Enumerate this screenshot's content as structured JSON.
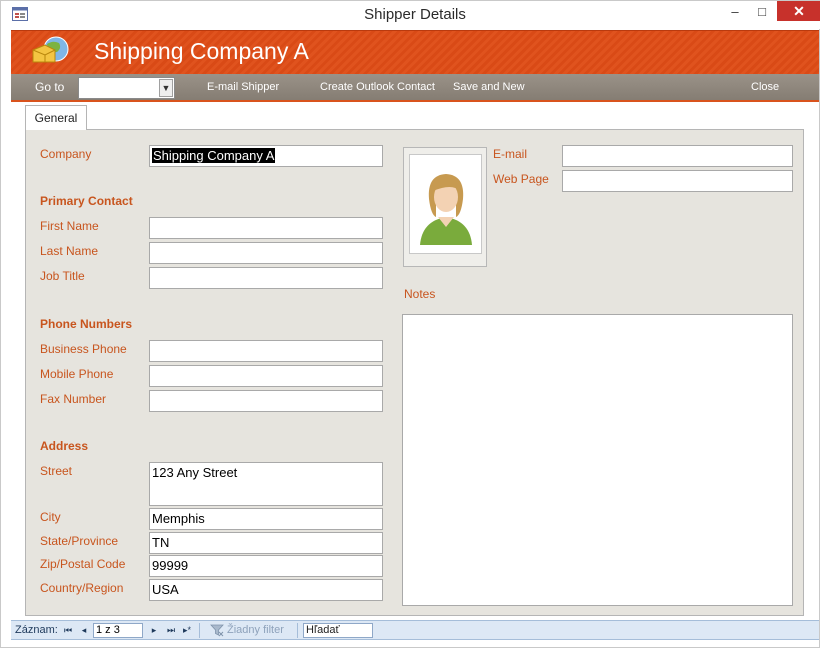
{
  "window": {
    "title": "Shipper Details",
    "minimize_glyph": "–",
    "maximize_glyph": "□",
    "close_glyph": "✕"
  },
  "header": {
    "title": "Shipping Company A",
    "logo_icon": "shipper-logo-icon",
    "band_color": "#e0531e"
  },
  "toolbar": {
    "goto_label": "Go to",
    "goto_value": "",
    "email_label": "E-mail Shipper",
    "outlook_label": "Create Outlook Contact",
    "save_new_label": "Save and New",
    "close_label": "Close"
  },
  "tabs": [
    {
      "label": "General",
      "active": true
    }
  ],
  "form": {
    "company": {
      "label": "Company",
      "value": "Shipping Company A"
    },
    "primary_contact": {
      "heading": "Primary Contact",
      "first_name": {
        "label": "First Name",
        "value": ""
      },
      "last_name": {
        "label": "Last Name",
        "value": ""
      },
      "job_title": {
        "label": "Job Title",
        "value": ""
      }
    },
    "phone_numbers": {
      "heading": "Phone Numbers",
      "business": {
        "label": "Business Phone",
        "value": ""
      },
      "mobile": {
        "label": "Mobile Phone",
        "value": ""
      },
      "fax": {
        "label": "Fax Number",
        "value": ""
      }
    },
    "address": {
      "heading": "Address",
      "street": {
        "label": "Street",
        "value": "123 Any Street"
      },
      "city": {
        "label": "City",
        "value": "Memphis"
      },
      "state": {
        "label": "State/Province",
        "value": "TN"
      },
      "zip": {
        "label": "Zip/Postal Code",
        "value": "99999"
      },
      "country": {
        "label": "Country/Region",
        "value": "USA"
      }
    },
    "email": {
      "label": "E-mail",
      "value": ""
    },
    "web_page": {
      "label": "Web Page",
      "value": ""
    },
    "notes": {
      "label": "Notes",
      "value": ""
    },
    "label_color": "#c8551e"
  },
  "statusbar": {
    "record_label": "Záznam:",
    "record_position": "1 z 3",
    "filter_label": "Žiadny filter",
    "search_placeholder": "Hľadať",
    "first_glyph": "⏮",
    "prev_glyph": "◂",
    "next_glyph": "▸",
    "last_glyph": "⏭",
    "new_glyph": "▸*"
  }
}
